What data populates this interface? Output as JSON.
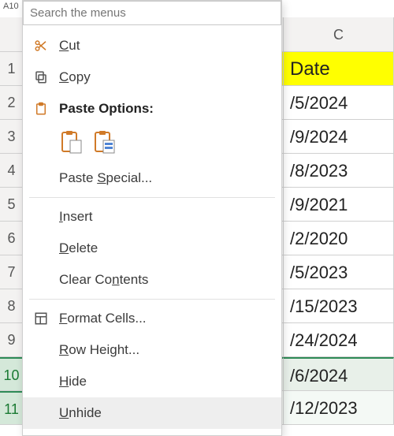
{
  "name_box": "A10",
  "search_placeholder": "Search the menus",
  "columns": {
    "B": "",
    "C": "C"
  },
  "header_row": {
    "C": "Date"
  },
  "data_rows": [
    {
      "n": "1",
      "C": "Date",
      "header": true
    },
    {
      "n": "2",
      "C": "/5/2024"
    },
    {
      "n": "3",
      "C": "/9/2024"
    },
    {
      "n": "4",
      "C": "/8/2023"
    },
    {
      "n": "5",
      "C": "/9/2021"
    },
    {
      "n": "6",
      "C": "/2/2020"
    },
    {
      "n": "7",
      "C": "/5/2023"
    },
    {
      "n": "8",
      "C": "/15/2023"
    },
    {
      "n": "9",
      "C": "/24/2024"
    },
    {
      "n": "10",
      "C": "/6/2024",
      "sel": "sel10"
    },
    {
      "n": "11",
      "C": "/12/2023",
      "sel": "sel11"
    }
  ],
  "menu": {
    "cut": "Cut",
    "copy": "Copy",
    "paste_options": "Paste Options:",
    "paste_special": "Paste Special...",
    "insert": "Insert",
    "delete": "Delete",
    "clear_contents": "Clear Contents",
    "format_cells": "Format Cells...",
    "row_height": "Row Height...",
    "hide": "Hide",
    "unhide": "Unhide"
  }
}
